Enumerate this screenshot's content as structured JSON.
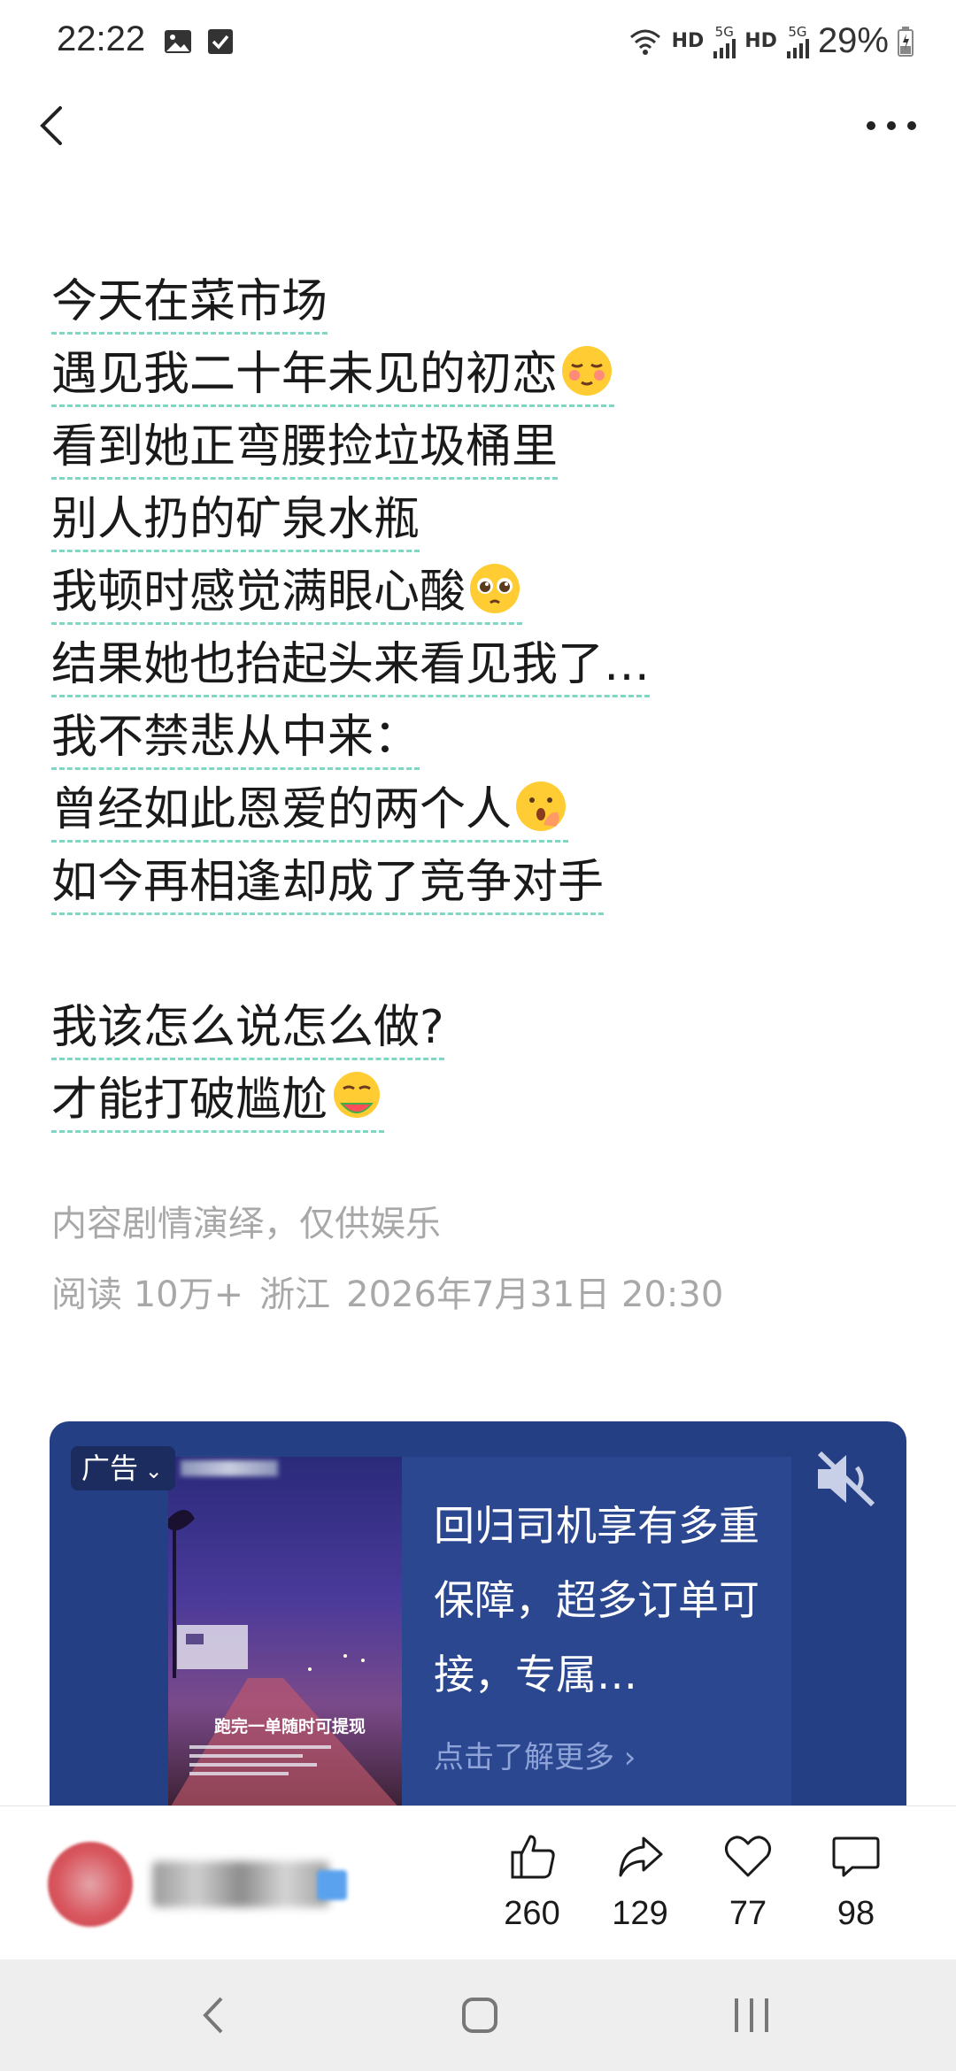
{
  "status_bar": {
    "time": "22:22",
    "network_1": "HD",
    "network_2": "HD",
    "signal_label_1": "5G",
    "signal_label_2": "5G",
    "battery": "29%"
  },
  "article": {
    "lines": [
      "今天在菜市场",
      "遇见我二十年未见的初恋",
      "看到她正弯腰捡垃圾桶里",
      "别人扔的矿泉水瓶",
      "我顿时感觉满眼心酸",
      "结果她也抬起头来看见我了…",
      "我不禁悲从中来：",
      "曾经如此恩爱的两个人",
      "如今再相逢却成了竞争对手",
      "我该怎么说怎么做?",
      "才能打破尴尬"
    ],
    "disclaimer": "内容剧情演绎，仅供娱乐",
    "meta": {
      "reads": "阅读 10万+",
      "location": "浙江",
      "datetime": "2026年7月31日 20:30"
    }
  },
  "ad": {
    "tag": "广告",
    "video_caption": "跑完一单随时可提现",
    "headline": "回归司机享有多重保障，超多订单可接，专属…",
    "cta": "点击了解更多 ›",
    "colors": {
      "card": "#253f85",
      "textbox": "#2b4790"
    }
  },
  "actions": {
    "like_count": "260",
    "share_count": "129",
    "favorite_count": "77",
    "comment_count": "98"
  },
  "colors": {
    "underline": "#7fd6c3",
    "meta_text": "#a8a8a8"
  }
}
